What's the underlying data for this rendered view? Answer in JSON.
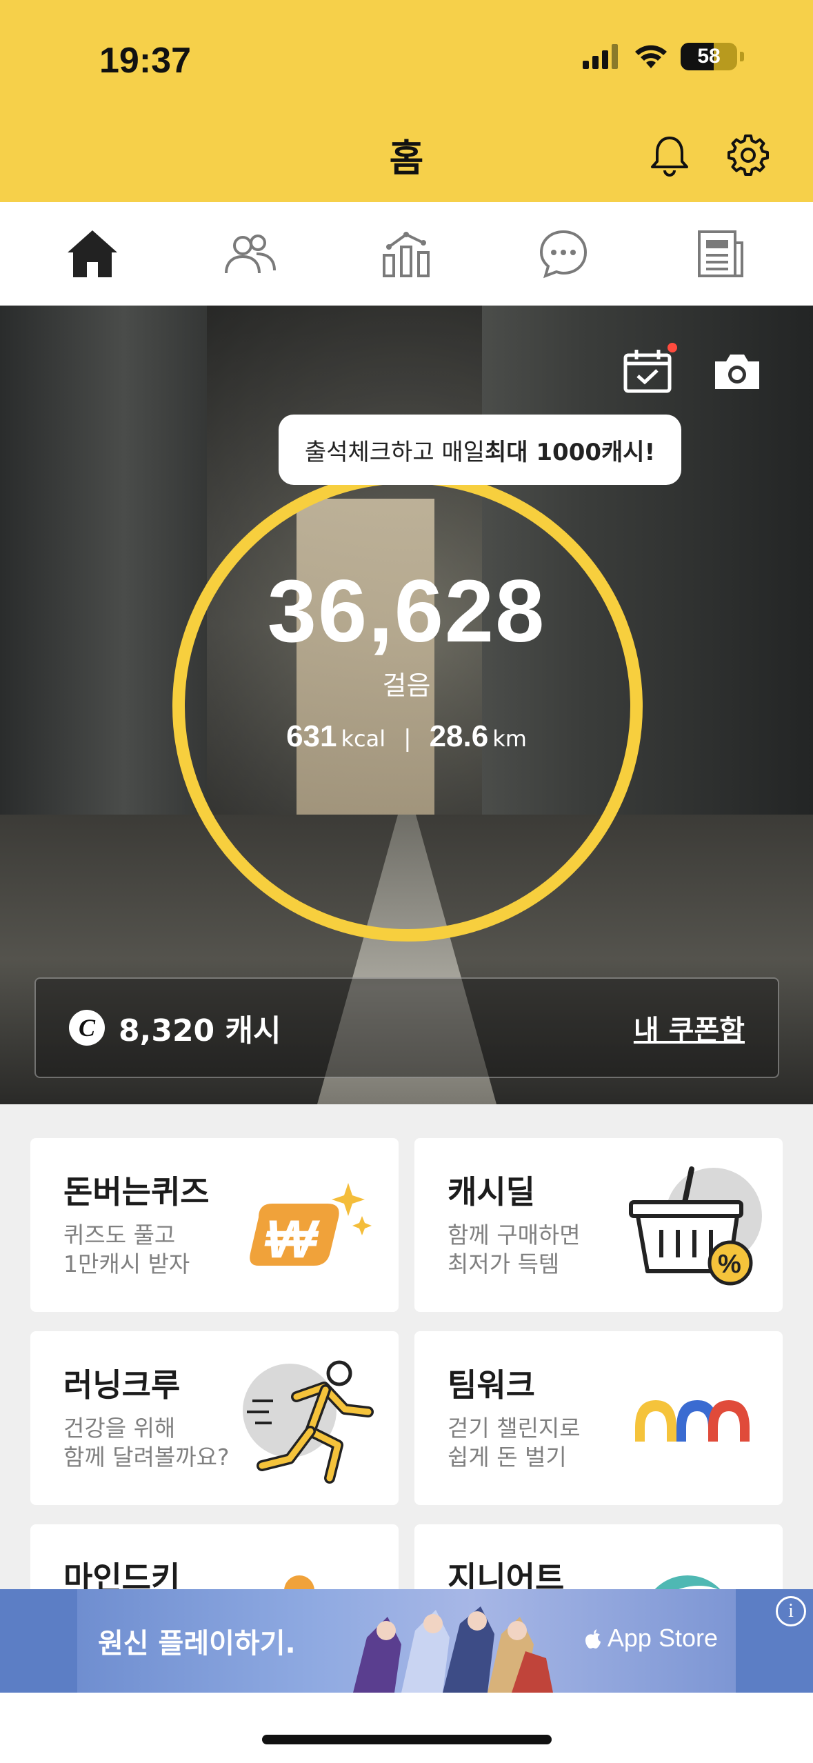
{
  "status": {
    "time": "19:37",
    "battery": "58",
    "battery_level_pct": 58
  },
  "header": {
    "title": "홈"
  },
  "tabs": [
    {
      "id": "home",
      "icon": "home-icon"
    },
    {
      "id": "friends",
      "icon": "people-icon"
    },
    {
      "id": "stats",
      "icon": "chart-icon"
    },
    {
      "id": "chat",
      "icon": "chat-icon"
    },
    {
      "id": "news",
      "icon": "newspaper-icon"
    }
  ],
  "hero": {
    "tooltip_prefix": "출석체크하고 매일 ",
    "tooltip_bold": "최대 1000캐시!",
    "steps": "36,628",
    "steps_label": "걸음",
    "calories": "631",
    "calories_unit": "kcal",
    "separator": "|",
    "distance": "28.6",
    "distance_unit": "km",
    "cash_icon": "C",
    "cash": "8,320 캐시",
    "coupon_link": "내 쿠폰함"
  },
  "cards": [
    {
      "title": "돈버는퀴즈",
      "sub1": "퀴즈도 풀고",
      "sub2": "1만캐시 받자"
    },
    {
      "title": "캐시딜",
      "sub1": "함께 구매하면",
      "sub2": "최저가 득템"
    },
    {
      "title": "러닝크루",
      "sub1": "건강을 위해",
      "sub2": "함께 달려볼까요?"
    },
    {
      "title": "팀워크",
      "sub1": "걷기 챌린지로",
      "sub2": "쉽게 돈 벌기"
    },
    {
      "title": "마인드키",
      "sub1": "",
      "sub2": ""
    },
    {
      "title": "지니어트",
      "sub1": "",
      "sub2": ""
    }
  ],
  "ad": {
    "text": "원신 플레이하기.",
    "store": "App Store",
    "info": "i"
  },
  "colors": {
    "accent": "#f6d04a",
    "ring": "#f7cf3e",
    "quiz_orange": "#f0a23a",
    "teamwork_blue": "#3a6bd1",
    "teamwork_red": "#e04b3a"
  }
}
